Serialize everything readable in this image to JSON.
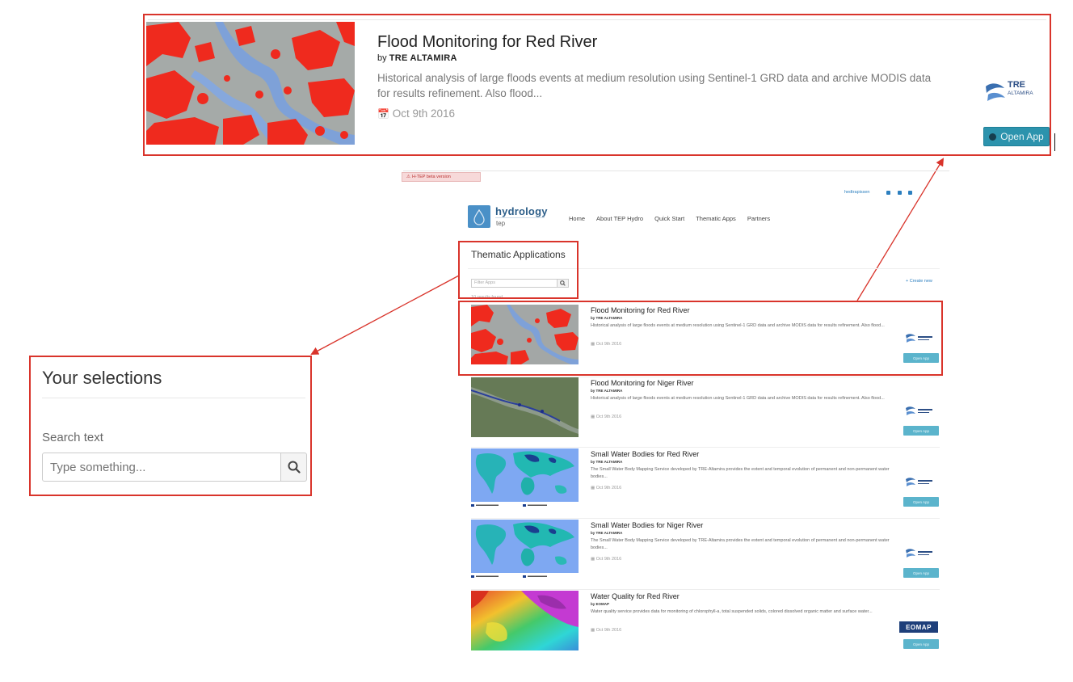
{
  "zoom_card": {
    "title": "Flood Monitoring for Red River",
    "by_prefix": "by",
    "author": "TRE ALTAMIRA",
    "description": "Historical analysis of large floods events at medium resolution using Sentinel-1 GRD data and archive MODIS data for results refinement. Also flood...",
    "date": "Oct 9th 2016",
    "open_label": "Open App",
    "logo_text_line1": "TRE",
    "logo_text_line2": "ALTAMIRA"
  },
  "selections": {
    "title": "Your selections",
    "search_label": "Search text",
    "search_placeholder": "Type something..."
  },
  "mini_page": {
    "beta_badge": "H-TEP beta version",
    "user_link": "hedtrapissen",
    "logo_text": "hydrology",
    "logo_sub": "tep",
    "nav": [
      "Home",
      "About TEP Hydro",
      "Quick Start",
      "Thematic Apps",
      "Partners"
    ],
    "section_title": "Thematic Applications",
    "filter_placeholder": "Filter Apps",
    "create_label": "+ Create new",
    "results_text": "10 results found",
    "apps": [
      {
        "title": "Flood Monitoring for Red River",
        "author": "by TRE ALTAMIRA",
        "description": "Historical analysis of large floods events at medium resolution using Sentinel-1 GRD data and archive MODIS data for results refinement. Also flood...",
        "date": "Oct 9th 2016",
        "open_label": "Open App",
        "logo": "TRE ALTAMIRA"
      },
      {
        "title": "Flood Monitoring for Niger River",
        "author": "by TRE ALTAMIRA",
        "description": "Historical analysis of large floods events at medium resolution using Sentinel-1 GRD data and archive MODIS data for results refinement. Also flood...",
        "date": "Oct 9th 2016",
        "open_label": "Open App",
        "logo": "TRE ALTAMIRA"
      },
      {
        "title": "Small Water Bodies for Red River",
        "author": "by TRE ALTAMIRA",
        "description": "The Small Water Body Mapping Service developed by TRE-Altamira provides the extent and temporal evolution of permanent and non-permanent water bodies...",
        "date": "Oct 9th 2016",
        "open_label": "Open App",
        "logo": "TRE ALTAMIRA"
      },
      {
        "title": "Small Water Bodies for Niger River",
        "author": "by TRE ALTAMIRA",
        "description": "The Small Water Body Mapping Service developed by TRE-Altamira provides the extent and temporal evolution of permanent and non-permanent water bodies...",
        "date": "Oct 9th 2016",
        "open_label": "Open App",
        "logo": "TRE ALTAMIRA"
      },
      {
        "title": "Water Quality for Red River",
        "author": "by EOMAP",
        "description": "Water quality service provides data for monitoring of chlorophyll-a, total suspended solids, colored dissolved organic matter and surface water...",
        "date": "Oct 9th 2016",
        "open_label": "Open App",
        "logo": "EOMAP"
      }
    ]
  },
  "colors": {
    "annotation_red": "#d9342b",
    "open_button": "#2c93ad",
    "link_blue": "#2c7fbf"
  }
}
